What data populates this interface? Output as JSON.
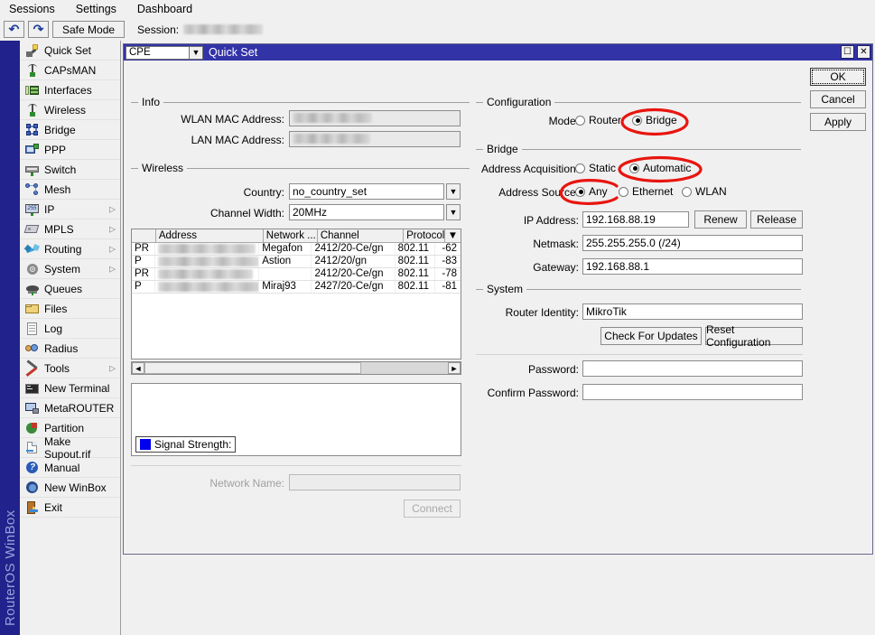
{
  "menubar": {
    "items": [
      {
        "label": "Sessions"
      },
      {
        "label": "Settings"
      },
      {
        "label": "Dashboard"
      }
    ]
  },
  "toolbar": {
    "undo_icon": "undo-arrow-icon",
    "redo_icon": "redo-arrow-icon",
    "safe_mode": "Safe Mode",
    "session_label": "Session:",
    "session_value_redacted": true
  },
  "brand": {
    "text": "RouterOS WinBox"
  },
  "sidebar": {
    "items": [
      {
        "label": "Quick Set",
        "icon": "wand-icon",
        "submenu": false
      },
      {
        "label": "CAPsMAN",
        "icon": "antenna-icon",
        "submenu": false
      },
      {
        "label": "Interfaces",
        "icon": "interfaces-icon",
        "submenu": false
      },
      {
        "label": "Wireless",
        "icon": "antenna-icon",
        "submenu": false
      },
      {
        "label": "Bridge",
        "icon": "bridge-icon",
        "submenu": false
      },
      {
        "label": "PPP",
        "icon": "ppp-icon",
        "submenu": false
      },
      {
        "label": "Switch",
        "icon": "switch-icon",
        "submenu": false
      },
      {
        "label": "Mesh",
        "icon": "mesh-icon",
        "submenu": false
      },
      {
        "label": "IP",
        "icon": "ip-icon",
        "submenu": true
      },
      {
        "label": "MPLS",
        "icon": "mpls-icon",
        "submenu": true
      },
      {
        "label": "Routing",
        "icon": "routing-icon",
        "submenu": true
      },
      {
        "label": "System",
        "icon": "gear-icon",
        "submenu": true
      },
      {
        "label": "Queues",
        "icon": "queues-icon",
        "submenu": false
      },
      {
        "label": "Files",
        "icon": "folder-icon",
        "submenu": false
      },
      {
        "label": "Log",
        "icon": "log-icon",
        "submenu": false
      },
      {
        "label": "Radius",
        "icon": "radius-icon",
        "submenu": false
      },
      {
        "label": "Tools",
        "icon": "tools-icon",
        "submenu": true
      },
      {
        "label": "New Terminal",
        "icon": "terminal-icon",
        "submenu": false
      },
      {
        "label": "MetaROUTER",
        "icon": "metarouter-icon",
        "submenu": false
      },
      {
        "label": "Partition",
        "icon": "partition-icon",
        "submenu": false
      },
      {
        "label": "Make Supout.rif",
        "icon": "supout-icon",
        "submenu": false
      },
      {
        "label": "Manual",
        "icon": "help-icon",
        "submenu": false
      },
      {
        "label": "New WinBox",
        "icon": "winbox-icon",
        "submenu": false
      },
      {
        "label": "Exit",
        "icon": "exit-icon",
        "submenu": false
      }
    ]
  },
  "window": {
    "mode_combo_value": "CPE",
    "title": "Quick Set",
    "restore_icon": "restore-icon",
    "close_icon": "close-icon"
  },
  "actions": {
    "ok": "OK",
    "cancel": "Cancel",
    "apply": "Apply"
  },
  "info": {
    "legend": "Info",
    "wlan_mac_label": "WLAN MAC Address:",
    "wlan_mac_value": "",
    "lan_mac_label": "LAN MAC Address:",
    "lan_mac_value": ""
  },
  "wireless": {
    "legend": "Wireless",
    "country_label": "Country:",
    "country_value": "no_country_set",
    "channel_width_label": "Channel Width:",
    "channel_width_value": "20MHz",
    "network_name_label": "Network Name:",
    "network_name_value": "",
    "connect_label": "Connect",
    "signal_strength_label": "Signal Strength:",
    "signal_swatch_color": "#0000ee"
  },
  "scan_table": {
    "columns": [
      "",
      "Address",
      "Network ...",
      "Channel",
      "Protocol",
      ""
    ],
    "sort_column": "Address",
    "rows": [
      {
        "flags": "PR",
        "address": "",
        "network": "Megafon",
        "channel": "2412/20-Ce/gn",
        "protocol": "802.11",
        "signal": "-62"
      },
      {
        "flags": "P",
        "address": "",
        "network": "Astion",
        "channel": "2412/20/gn",
        "protocol": "802.11",
        "signal": "-83"
      },
      {
        "flags": "PR",
        "address": "",
        "network": "",
        "channel": "2412/20-Ce/gn",
        "protocol": "802.11",
        "signal": "-78"
      },
      {
        "flags": "P",
        "address": "",
        "network": "Miraj93",
        "channel": "2427/20-Ce/gn",
        "protocol": "802.11",
        "signal": "-81"
      }
    ]
  },
  "configuration": {
    "legend": "Configuration",
    "mode_label": "Mode:",
    "mode_options": [
      "Router",
      "Bridge"
    ],
    "mode_selected": "Bridge"
  },
  "bridge": {
    "legend": "Bridge",
    "address_acquisition_label": "Address Acquisition:",
    "address_acquisition_options": [
      "Static",
      "Automatic"
    ],
    "address_acquisition_selected": "Automatic",
    "address_source_label": "Address Source:",
    "address_source_options": [
      "Any",
      "Ethernet",
      "WLAN"
    ],
    "address_source_selected": "Any",
    "ip_address_label": "IP Address:",
    "ip_address_value": "192.168.88.19",
    "renew_label": "Renew",
    "release_label": "Release",
    "netmask_label": "Netmask:",
    "netmask_value": "255.255.255.0 (/24)",
    "gateway_label": "Gateway:",
    "gateway_value": "192.168.88.1"
  },
  "system": {
    "legend": "System",
    "router_identity_label": "Router Identity:",
    "router_identity_value": "MikroTik",
    "check_updates_label": "Check For Updates",
    "reset_config_label": "Reset Configuration",
    "password_label": "Password:",
    "password_value": "",
    "confirm_password_label": "Confirm Password:",
    "confirm_password_value": ""
  },
  "annotations": {
    "color": "#e8150f",
    "highlights": [
      "Bridge",
      "Automatic",
      "Any"
    ]
  }
}
